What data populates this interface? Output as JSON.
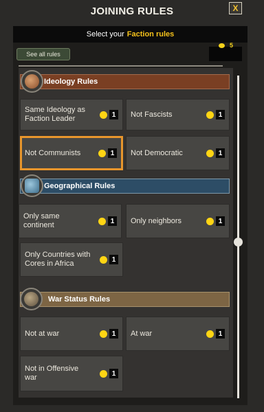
{
  "window": {
    "title": "JOINING RULES",
    "close_label": "X"
  },
  "subtitle": {
    "prefix": "Select your",
    "highlight": "Faction rules"
  },
  "see_all_label": "See all rules",
  "points": "5",
  "sections": [
    {
      "title": "Ideology Rules",
      "icon": "ideology-icon",
      "rules": [
        {
          "label": "Same Ideology as Faction Leader",
          "cost": "1"
        },
        {
          "label": "Not Fascists",
          "cost": "1"
        },
        {
          "label": "Not Communists",
          "cost": "1",
          "selected": true
        },
        {
          "label": "Not Democratic",
          "cost": "1"
        }
      ]
    },
    {
      "title": "Geographical Rules",
      "icon": "globe-icon",
      "rules": [
        {
          "label": "Only same continent",
          "cost": "1"
        },
        {
          "label": "Only neighbors",
          "cost": "1"
        },
        {
          "label": "Only Countries with Cores in Africa",
          "cost": "1"
        }
      ]
    },
    {
      "title": "War Status Rules",
      "icon": "war-icon",
      "rules": [
        {
          "label": "Not at war",
          "cost": "1"
        },
        {
          "label": "At war",
          "cost": "1"
        },
        {
          "label": "Not in Offensive war",
          "cost": "1"
        }
      ]
    }
  ],
  "colors": {
    "accent_gold": "#f6c21b",
    "selected_border": "#e8962c",
    "ideology_header": "#7a3f23",
    "geography_header": "#2d4d66",
    "war_header": "#7d6544"
  }
}
